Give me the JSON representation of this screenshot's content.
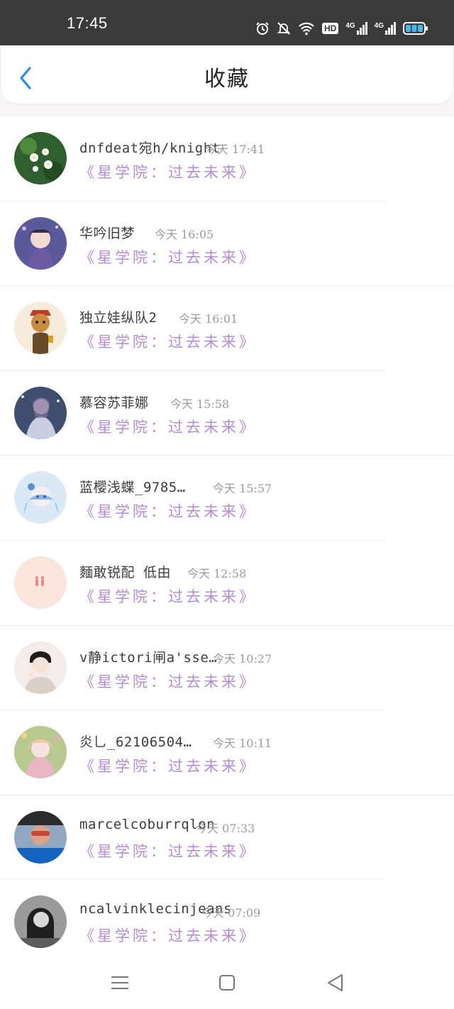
{
  "status_bar": {
    "time": "17:45",
    "icons": [
      "alarm-icon",
      "mute-icon",
      "wifi-icon",
      "hd-icon",
      "signal-icon",
      "signal-icon",
      "battery-icon"
    ],
    "hd_label": "HD",
    "net1": "4G",
    "net2": "4G",
    "battery_color": "#4db6e8"
  },
  "header": {
    "title": "收藏",
    "back_icon": "chevron-left-icon",
    "back_color": "#2b8be6"
  },
  "colors": {
    "name": "#3c3c3c",
    "time": "#9b9b9b",
    "book": "#b48bd6"
  },
  "favorites": [
    {
      "name": "dnfdeat宛h/knight",
      "time": "今天 17:41",
      "book": "《星学院：过去未来》"
    },
    {
      "name": "华吟旧梦",
      "time": "今天 16:05",
      "book": "《星学院：过去未来》"
    },
    {
      "name": "独立娃纵队2",
      "time": "今天 16:01",
      "book": "《星学院：过去未来》"
    },
    {
      "name": "慕容苏菲娜",
      "time": "今天 15:58",
      "book": "《星学院：过去未来》"
    },
    {
      "name": "蓝樱浅蝶_9785…",
      "time": "今天 15:57",
      "book": "《星学院：过去未来》"
    },
    {
      "name": "麵敢锐配 低由",
      "time": "今天 12:58",
      "book": "《星学院：过去未来》"
    },
    {
      "name": "v静ictori闸a'sse…",
      "time": "今天 10:27",
      "book": "《星学院：过去未来》"
    },
    {
      "name": "炎乚_62106504…",
      "time": "今天 10:11",
      "book": "《星学院：过去未来》"
    },
    {
      "name": "marcelcoburrqlon",
      "time": "今天 07:33",
      "book": "《星学院：过去未来》"
    },
    {
      "name": "ncalvinklecinjeans",
      "time": "今天 07:09",
      "book": "《星学院：过去未来》"
    }
  ],
  "nav_bar": {
    "icons": [
      "menu-icon",
      "home-square-icon",
      "back-triangle-icon"
    ]
  }
}
